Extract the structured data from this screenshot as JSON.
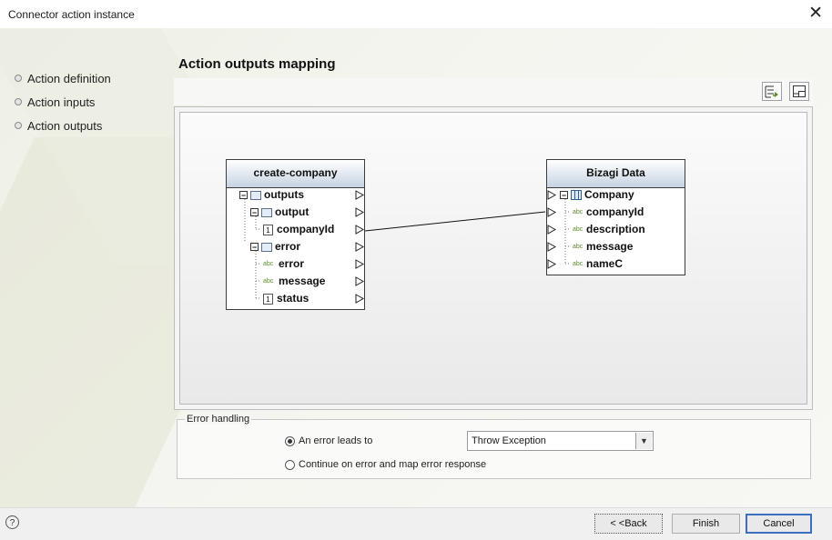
{
  "window": {
    "title": "Connector action instance",
    "close_glyph": "✕"
  },
  "nav": {
    "items": [
      "Action definition",
      "Action inputs",
      "Action outputs"
    ]
  },
  "section": {
    "title": "Action outputs mapping"
  },
  "toolbar": {
    "icons": [
      "auto-map-icon",
      "layout-icon"
    ]
  },
  "source_box": {
    "title": "create-company",
    "items": [
      {
        "label": "outputs",
        "type": "object"
      },
      {
        "label": "output",
        "type": "object"
      },
      {
        "label": "companyId",
        "type": "number"
      },
      {
        "label": "error",
        "type": "object"
      },
      {
        "label": "error",
        "type": "string"
      },
      {
        "label": "message",
        "type": "string"
      },
      {
        "label": "status",
        "type": "number"
      }
    ]
  },
  "target_box": {
    "title": "Bizagi Data",
    "items": [
      {
        "label": "Company",
        "type": "entity"
      },
      {
        "label": "companyId",
        "type": "string"
      },
      {
        "label": "description",
        "type": "string"
      },
      {
        "label": "message",
        "type": "string"
      },
      {
        "label": "nameC",
        "type": "string"
      }
    ]
  },
  "mapping": {
    "from": "companyId",
    "to": "companyId"
  },
  "error_handling": {
    "legend": "Error handling",
    "option1": "An error leads to",
    "option2": "Continue on error and map error response",
    "selected": "An error leads to",
    "select_value": "Throw Exception"
  },
  "footer": {
    "back": "< <Back",
    "finish": "Finish",
    "cancel": "Cancel",
    "help": "?"
  },
  "colors": {
    "header_gradient": "#c6d3e3",
    "accent": "#3b6fc2",
    "string_icon": "#5b8c2a"
  }
}
